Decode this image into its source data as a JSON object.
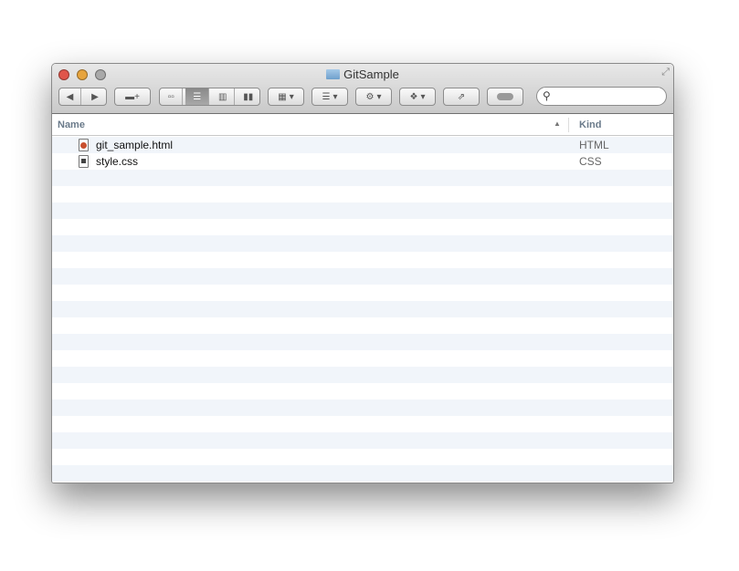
{
  "window": {
    "title": "GitSample"
  },
  "toolbar": {
    "search_placeholder": ""
  },
  "columns": {
    "name": "Name",
    "kind": "Kind",
    "sort_indicator": "▲"
  },
  "files": [
    {
      "name": "git_sample.html",
      "kind": "HTML",
      "icon": "html-file-icon"
    },
    {
      "name": "style.css",
      "kind": "CSS",
      "icon": "css-file-icon"
    }
  ]
}
